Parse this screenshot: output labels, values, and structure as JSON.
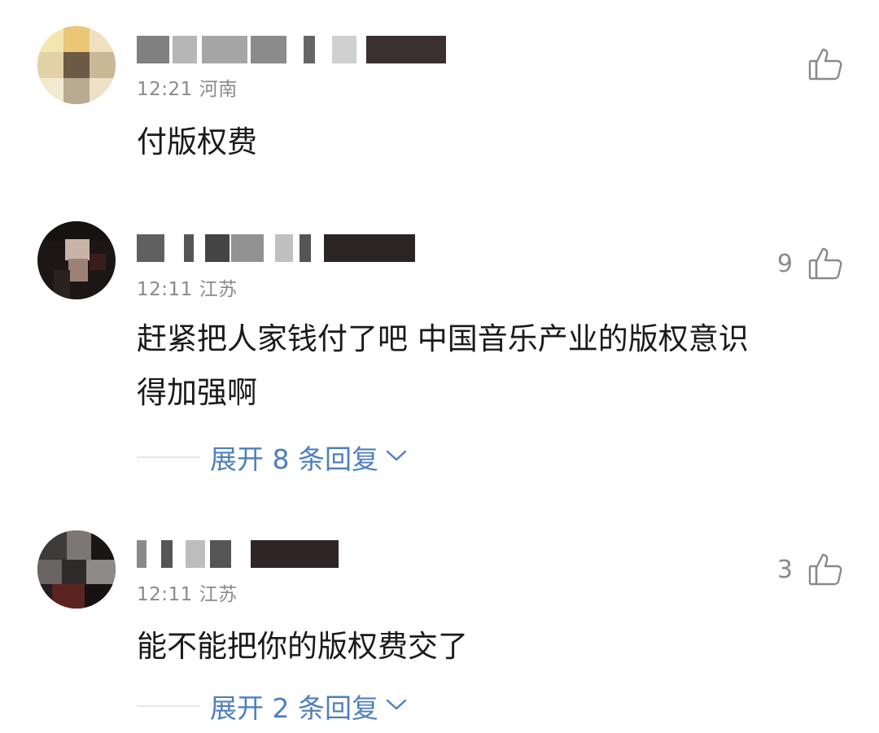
{
  "comments": [
    {
      "time": "12:21",
      "location": "河南",
      "likes": "",
      "text": "付版权费",
      "icons": {
        "like": "thumbs-up-icon"
      }
    },
    {
      "time": "12:11",
      "location": "江苏",
      "likes": "9",
      "text_line1": "赶紧把人家钱付了吧 中国音乐产业的版权意识",
      "text_line2": "得加强啊",
      "replies_label": "展开 8 条回复",
      "icons": {
        "like": "thumbs-up-icon",
        "expand": "chevron-down-icon"
      }
    },
    {
      "time": "12:11",
      "location": "江苏",
      "likes": "3",
      "text": "能不能把你的版权费交了",
      "replies_label": "展开 2 条回复",
      "icons": {
        "like": "thumbs-up-icon",
        "expand": "chevron-down-icon"
      }
    }
  ],
  "colors": {
    "meta_text": "#8a8a8a",
    "body_text": "#1a1a1a",
    "reply_link": "#4f7fbd",
    "divider": "#e6e6e6"
  }
}
